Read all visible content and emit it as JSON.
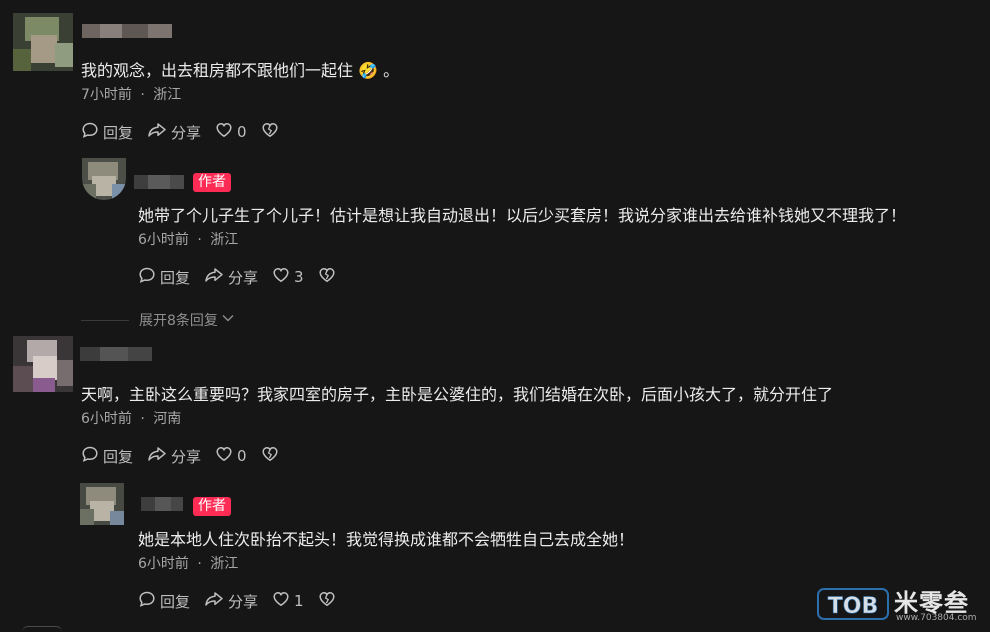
{
  "comments": [
    {
      "text": "我的观念，出去租房都不跟他们一起住 🤣 。",
      "time": "7小时前",
      "location": "浙江",
      "dot": "·",
      "reply_label": "回复",
      "share_label": "分享",
      "likes": "0"
    },
    {
      "author_tag": "作者",
      "text": "她带了个儿子生了个儿子！估计是想让我自动退出！以后少买套房！我说分家谁出去给谁补钱她又不理我了！",
      "time": "6小时前",
      "location": "浙江",
      "dot": "·",
      "reply_label": "回复",
      "share_label": "分享",
      "likes": "3"
    },
    {
      "expand_label": "展开8条回复"
    },
    {
      "text": "天啊，主卧这么重要吗？我家四室的房子，主卧是公婆住的，我们结婚在次卧，后面小孩大了，就分开住了",
      "time": "6小时前",
      "location": "河南",
      "dot": "·",
      "reply_label": "回复",
      "share_label": "分享",
      "likes": "0"
    },
    {
      "author_tag": "作者",
      "text": "她是本地人住次卧抬不起头！我觉得换成谁都不会牺牲自己去成全她！",
      "time": "6小时前",
      "location": "浙江",
      "dot": "·",
      "reply_label": "回复",
      "share_label": "分享",
      "likes": "1"
    }
  ],
  "watermark": {
    "logo": "TOB",
    "brand": "米零叁",
    "url": "www.703804.com"
  },
  "colors": {
    "background": "#161616",
    "author_tag": "#fe2c55",
    "meta": "#a7a7a7"
  }
}
